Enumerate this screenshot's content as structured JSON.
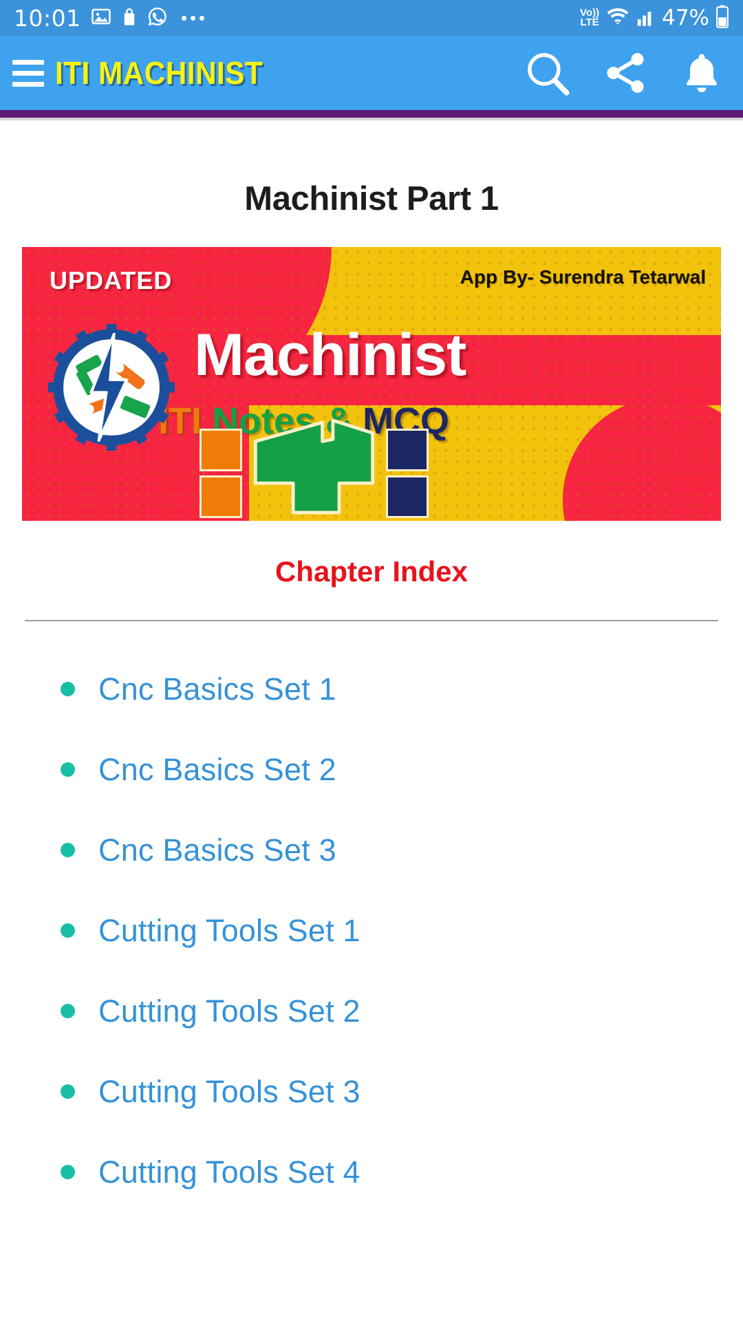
{
  "status_bar": {
    "time": "10:01",
    "left_icons": [
      "gallery-icon",
      "shopping-bag-icon",
      "whatsapp-icon",
      "more-dots-icon"
    ],
    "network_label_top": "Vo))",
    "network_label_bottom": "LTE",
    "battery_percent": "47%",
    "right_icons": [
      "volte-icon",
      "wifi-icon",
      "signal-icon",
      "battery-icon"
    ],
    "bg_color": "#3b93db"
  },
  "app_bar": {
    "menu_icon": "hamburger-menu-icon",
    "title": "ITI MACHINIST",
    "title_color": "#f5f312",
    "bg_color": "#3fa2ee",
    "actions": [
      {
        "name": "search-icon",
        "label": "Search"
      },
      {
        "name": "share-icon",
        "label": "Share"
      },
      {
        "name": "notification-bell-icon",
        "label": "Notifications"
      }
    ],
    "accent_divider_color": "#5c1a77"
  },
  "main": {
    "page_title": "Machinist Part 1",
    "banner": {
      "badge": "UPDATED",
      "credit": "App By- Surendra Tetarwal",
      "headline": "Machinist",
      "subtitle_parts": {
        "first": "ITI",
        "second": "Notes &",
        "third": "MCQ"
      },
      "logo_name": "iti-gear-tools-logo",
      "blocks_name": "iti-block-letters",
      "colors": {
        "red": "#f72541",
        "yellow": "#f3c20d",
        "orange": "#ef7c08",
        "green": "#13a046",
        "navy": "#1d2763"
      }
    },
    "section_heading": "Chapter Index",
    "section_heading_color": "#e8131a",
    "chapters": [
      {
        "label": "Cnc Basics Set 1"
      },
      {
        "label": "Cnc Basics Set 2"
      },
      {
        "label": "Cnc Basics Set 3"
      },
      {
        "label": "Cutting Tools Set 1"
      },
      {
        "label": "Cutting Tools Set 2"
      },
      {
        "label": "Cutting Tools Set 3"
      },
      {
        "label": "Cutting Tools Set 4"
      }
    ],
    "link_color": "#3592d8",
    "bullet_color": "#18bfa6"
  }
}
